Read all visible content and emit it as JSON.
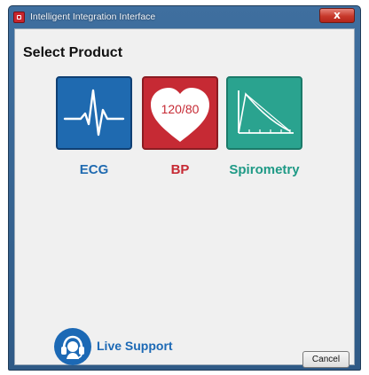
{
  "window": {
    "title": "Intelligent Integration Interface",
    "close_glyph": "x"
  },
  "main": {
    "heading": "Select Product",
    "products": [
      {
        "name": "ECG",
        "icon": "ecg-waveform-icon",
        "color": "#1f6ab0"
      },
      {
        "name": "BP",
        "icon": "heart-blood-pressure-icon",
        "icon_text": "120/80",
        "color": "#c62a34"
      },
      {
        "name": "Spirometry",
        "icon": "spirometry-graph-icon",
        "color": "#2aa38f"
      }
    ]
  },
  "footer": {
    "support_label": "Live Support",
    "support_icon": "headset-icon",
    "cancel_label": "Cancel"
  }
}
